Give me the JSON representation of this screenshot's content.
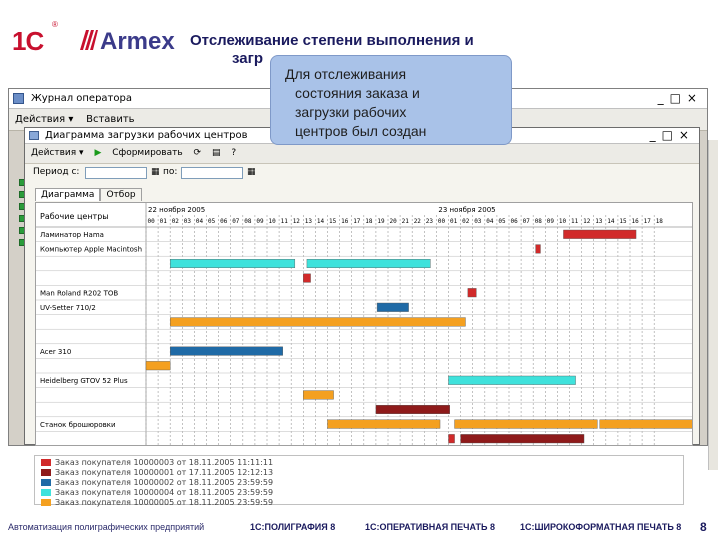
{
  "header": {
    "logo_1c": "1С",
    "logo_armex": "Armex",
    "title_line1": "Отслеживание степени выполнения и",
    "title_line2": "загр"
  },
  "callout": {
    "lines": [
      "Для отслеживания",
      "состояния заказа и",
      "загрузки рабочих",
      "центров был создан"
    ]
  },
  "outer_window": {
    "title": "Журнал оператора",
    "menu_actions": "Действия ▾",
    "menu_insert": "Вставить"
  },
  "inner_window": {
    "title": "Диаграмма загрузки рабочих центров",
    "toolbar_actions": "Действия ▾",
    "toolbar_generate": "Сформировать",
    "period_label": "Период с:",
    "period_to": "по:",
    "tabs": [
      "Диаграмма",
      "Отбор"
    ]
  },
  "chart": {
    "header_label": "Рабочие центры",
    "date_left": "22 ноября 2005",
    "date_right": "23 ноября 2005",
    "hours_left": [
      "00",
      "01",
      "02",
      "03",
      "04",
      "05",
      "06",
      "07",
      "08",
      "09",
      "10",
      "11",
      "12",
      "13",
      "14",
      "15",
      "16",
      "17",
      "18",
      "19",
      "20",
      "21",
      "22",
      "23"
    ],
    "hours_right": [
      "00",
      "01",
      "02",
      "03",
      "04",
      "05",
      "06",
      "07",
      "08",
      "09",
      "10",
      "11",
      "12",
      "13",
      "14",
      "15",
      "16",
      "17",
      "18"
    ],
    "rows": [
      "Ламинатор Hama",
      "Компьютер Apple Macintosh",
      "",
      "",
      "Man Roland R202 TOB",
      "UV-Setter 710/2",
      "",
      "",
      "Acer 310",
      "",
      "Heidelberg GTOV 52 Plus",
      "",
      "",
      "Станок брошюровки",
      ""
    ],
    "colors": {
      "red": "#d12a2a",
      "darkred": "#8e1a1a",
      "cyan": "#3fe2dc",
      "blue": "#1f6aa6",
      "orange": "#f4a020"
    }
  },
  "legend": [
    {
      "color": "#d12a2a",
      "label": "Заказ покупателя 10000003 от 18.11.2005 11:11:11"
    },
    {
      "color": "#8e1a1a",
      "label": "Заказ покупателя 10000001 от 17.11.2005 12:12:13"
    },
    {
      "color": "#1f6aa6",
      "label": "Заказ покупателя 10000002 от 18.11.2005 23:59:59"
    },
    {
      "color": "#3fe2dc",
      "label": "Заказ покупателя 10000004 от 18.11.2005 23:59:59"
    },
    {
      "color": "#f4a020",
      "label": "Заказ покупателя 10000005 от 18.11.2005 23:59:59"
    }
  ],
  "footer": {
    "left": "Автоматизация полиграфических предприятий",
    "item1": "1С:ПОЛИГРАФИЯ 8",
    "item2": "1С:ОПЕРАТИВНАЯ ПЕЧАТЬ 8",
    "item3": "1С:ШИРОКОФОРМАТНАЯ ПЕЧАТЬ 8",
    "page": "8"
  }
}
